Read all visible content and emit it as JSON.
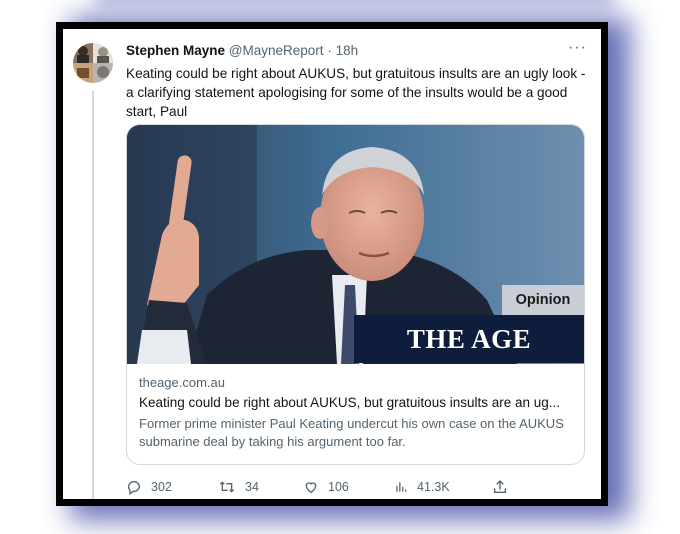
{
  "tweet": {
    "name": "Stephen Mayne",
    "handle": "@MayneReport",
    "dot": "·",
    "time": "18h",
    "more": "···",
    "text": "Keating could be right about AUKUS, but gratuitous insults are an ugly look - a clarifying statement apologising for some of the insults would be a good start, Paul"
  },
  "card": {
    "badge": "Opinion",
    "masthead": "THE AGE",
    "domain": "theage.com.au",
    "title": "Keating could be right about AUKUS, but gratuitous insults are an ug...",
    "description": "Former prime minister Paul Keating undercut his own case on the AUKUS submarine deal by taking his argument too far."
  },
  "actions": {
    "replies": "302",
    "retweets": "34",
    "likes": "106",
    "views": "41.3K"
  },
  "icons": {
    "reply": "reply-icon",
    "retweet": "retweet-icon",
    "like": "heart-icon",
    "views": "views-bar-chart-icon",
    "share": "share-icon",
    "more": "more-dots-icon"
  },
  "colors": {
    "text_primary": "#0f1419",
    "text_secondary": "#536471",
    "masthead_bg": "#0f1d3d",
    "frame_shadow": "#4a56a8"
  }
}
